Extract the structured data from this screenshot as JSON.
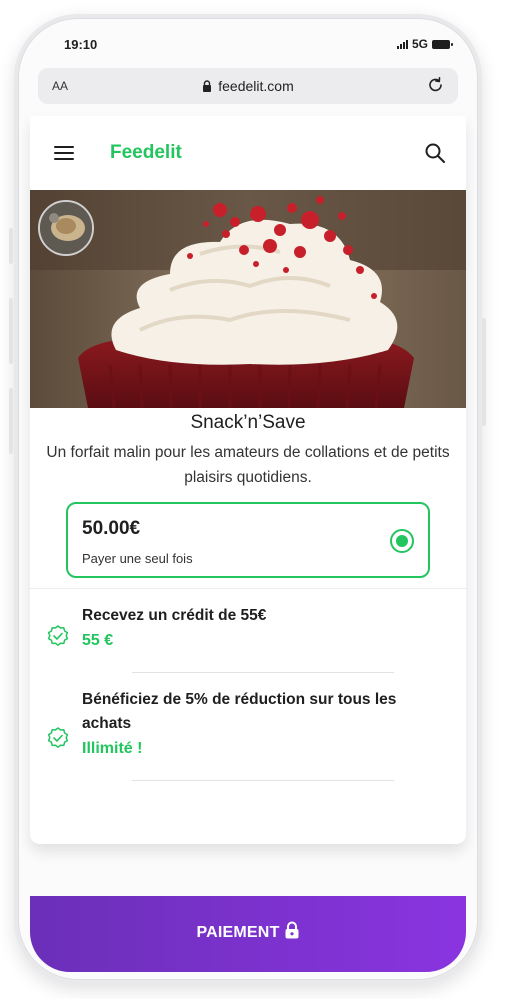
{
  "status_bar": {
    "time": "19:10",
    "network": "5G"
  },
  "browser": {
    "text_size_button": "AA",
    "url": "feedelit.com"
  },
  "header": {
    "brand": "Feedelit"
  },
  "product": {
    "title": "Snack’n’Save",
    "description": "Un forfait malin pour les amateurs de collations et de petits plaisirs quotidiens.",
    "price": "50.00€",
    "price_note": "Payer une seul fois",
    "selected": true
  },
  "features": [
    {
      "text": "Recevez un crédit de 55€",
      "value": "55 €"
    },
    {
      "text": "Bénéficiez de 5% de réduction sur tous les achats",
      "value": "Illimité !"
    }
  ],
  "checkout": {
    "label": "PAIEMENT"
  },
  "colors": {
    "accent": "#22c55e",
    "pay_start": "#6b2fb8",
    "pay_end": "#8a34e0"
  },
  "icons": {
    "menu": "menu-icon",
    "search": "search-icon",
    "lock": "lock-icon",
    "reload": "reload-icon",
    "feature": "badge-check-icon"
  }
}
